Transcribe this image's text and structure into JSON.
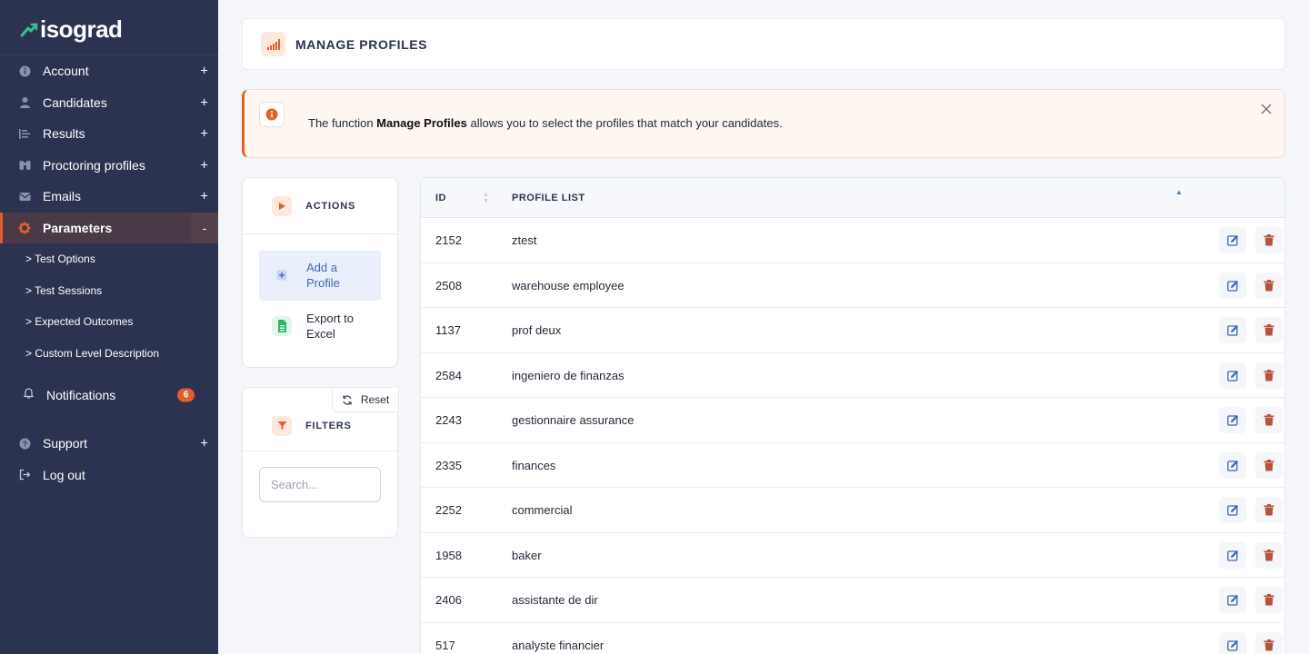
{
  "brand": {
    "name": "isograd"
  },
  "sidebar": {
    "items": [
      {
        "label": "Account",
        "icon": "info-icon",
        "toggle": "+"
      },
      {
        "label": "Candidates",
        "icon": "user-icon",
        "toggle": "+"
      },
      {
        "label": "Results",
        "icon": "list-icon",
        "toggle": "+"
      },
      {
        "label": "Proctoring profiles",
        "icon": "binoculars-icon",
        "toggle": "+"
      },
      {
        "label": "Emails",
        "icon": "envelope-icon",
        "toggle": "+"
      },
      {
        "label": "Parameters",
        "icon": "gear-icon",
        "toggle": "-"
      }
    ],
    "subitems": [
      "> Test Options",
      "> Test Sessions",
      "> Expected Outcomes",
      "> Custom Level Description"
    ],
    "notifications": {
      "label": "Notifications",
      "count": "6"
    },
    "bottom": [
      {
        "label": "Support",
        "icon": "question-icon",
        "toggle": "+"
      },
      {
        "label": "Log out",
        "icon": "logout-icon",
        "toggle": ""
      }
    ]
  },
  "header": {
    "title": "MANAGE PROFILES"
  },
  "alert": {
    "prefix": "The function ",
    "bold": "Manage Profiles",
    "suffix": " allows you to select the profiles that match your candidates."
  },
  "actions": {
    "title": "ACTIONS",
    "add_line1": "Add a",
    "add_line2": "Profile",
    "export_line1": "Export to",
    "export_line2": "Excel"
  },
  "filters": {
    "title": "FILTERS",
    "reset_label": "Reset",
    "search_placeholder": "Search..."
  },
  "table": {
    "columns": [
      "ID",
      "PROFILE LIST"
    ],
    "rows": [
      {
        "id": "2152",
        "name": "ztest"
      },
      {
        "id": "2508",
        "name": "warehouse employee"
      },
      {
        "id": "1137",
        "name": "prof deux"
      },
      {
        "id": "2584",
        "name": "ingeniero de finanzas"
      },
      {
        "id": "2243",
        "name": "gestionnaire assurance"
      },
      {
        "id": "2335",
        "name": "finances"
      },
      {
        "id": "2252",
        "name": "commercial"
      },
      {
        "id": "1958",
        "name": "baker"
      },
      {
        "id": "2406",
        "name": "assistante de dir"
      },
      {
        "id": "517",
        "name": "analyste financier"
      }
    ]
  },
  "colors": {
    "sidebar_bg": "#2b3350",
    "accent": "#e0602a",
    "link_blue": "#3f66b8",
    "delete_red": "#b5533a"
  }
}
